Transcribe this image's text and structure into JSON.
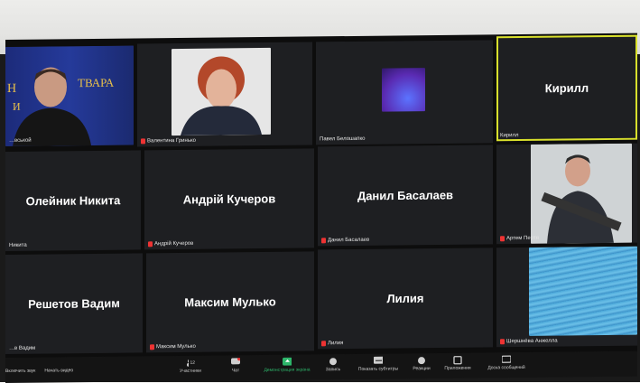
{
  "tiles": [
    {
      "kind": "video",
      "label": "…вськой"
    },
    {
      "kind": "video",
      "label": "Валентина Гринько",
      "muted": true
    },
    {
      "kind": "video",
      "label": "Павел Белошапко"
    },
    {
      "kind": "name",
      "name": "Кирилл",
      "label": "Кирилл",
      "active": true
    },
    {
      "kind": "name",
      "name": "Олейник Никита",
      "label": "Никита"
    },
    {
      "kind": "name",
      "name": "Андрій Кучеров",
      "label": "Андрій Кучеров",
      "muted": true
    },
    {
      "kind": "name",
      "name": "Данил Басалаев",
      "label": "Данил Басалаев",
      "muted": true
    },
    {
      "kind": "video",
      "label": "Артем Пертя",
      "muted": true
    },
    {
      "kind": "name",
      "name": "Решетов Вадим",
      "label": "…в Вадим"
    },
    {
      "kind": "name",
      "name": "Максим Мулько",
      "label": "Максим Мулько",
      "muted": true
    },
    {
      "kind": "name",
      "name": "Лилия",
      "label": "Лилия",
      "muted": true
    },
    {
      "kind": "video",
      "label": "Шершнёва Анжелла",
      "muted": true
    }
  ],
  "toolbar": {
    "left": [
      "Включить звук",
      "Начать видео"
    ],
    "participants_count": "12",
    "buttons": [
      "Участники",
      "Чат",
      "Демонстрация экрана",
      "Запись",
      "Показать субтитры",
      "Реакции",
      "Приложения",
      "Доска сообщений"
    ]
  },
  "colors": {
    "accent": "#d9e02c",
    "share": "#2db56a",
    "muted": "#e33333"
  }
}
